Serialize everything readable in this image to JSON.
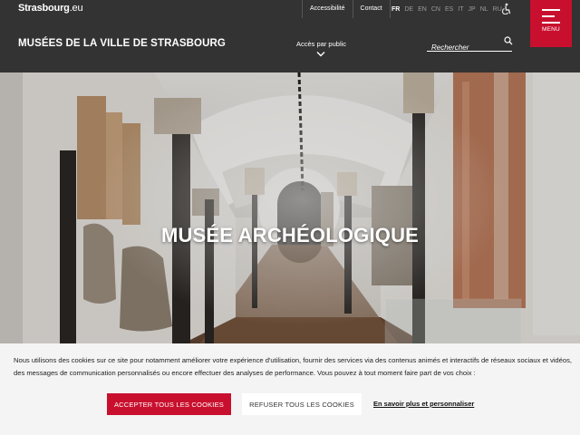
{
  "topbar": {
    "logo_main": "Strasbourg",
    "logo_suffix": ".eu",
    "links": [
      "Accessibilité",
      "Contact"
    ],
    "languages": [
      "FR",
      "DE",
      "EN",
      "CN",
      "ES",
      "IT",
      "JP",
      "NL",
      "RU"
    ],
    "active_language": "FR",
    "icon": "accessibility-icon"
  },
  "header": {
    "title": "MUSÉES DE LA VILLE DE STRASBOURG",
    "public_label": "Accès par public",
    "search_placeholder": "Rechercher",
    "menu_label": "MENU"
  },
  "hero": {
    "title": "MUSÉE ARCHÉOLOGIQUE"
  },
  "cookie": {
    "text": "Nous utilisons des cookies sur ce site pour notamment améliorer votre expérience d'utilisation, fournir des services via des contenus animés et interactifs de réseaux sociaux et vidéos, des messages de communication personnalisés ou encore effectuer des analyses de performance. Vous pouvez à tout moment faire part de vos choix :",
    "accept_label": "ACCEPTER TOUS LES COOKIES",
    "refuse_label": "REFUSER TOUS LES COOKIES",
    "more_label": "En savoir plus et personnaliser"
  },
  "colors": {
    "brand_red": "#c8102e",
    "header_bg": "#333333",
    "cookie_bg": "#f4f4f4"
  }
}
